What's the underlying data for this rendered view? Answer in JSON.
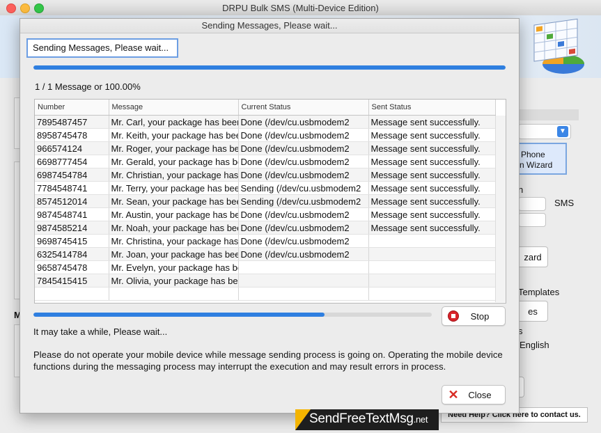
{
  "app": {
    "title": "DRPU Bulk SMS (Multi-Device Edition)"
  },
  "background": {
    "wizard_line1": "Phone",
    "wizard_line2": "n  Wizard",
    "sms_label": "SMS",
    "label_n": "n",
    "wizard_btn": "zard",
    "templates_label": "Templates",
    "es_btn": "es",
    "s_label": "s",
    "english_label": "English",
    "m_label": "M",
    "help_link": "Need Help? Click here to contact us."
  },
  "dialog": {
    "title": "Sending Messages, Please wait...",
    "status_box": "Sending Messages, Please wait...",
    "overall_progress": 1.0,
    "count_text": "1 / 1 Message or 100.00%",
    "columns": [
      "Number",
      "Message",
      "Current Status",
      "Sent Status"
    ],
    "rows": [
      {
        "number": "7895487457",
        "message": "Mr. Carl, your package has been",
        "status": "Done (/dev/cu.usbmodem2",
        "sent": "Message sent successfully."
      },
      {
        "number": "8958745478",
        "message": "Mr. Keith, your package has been",
        "status": "Done (/dev/cu.usbmodem2",
        "sent": "Message sent successfully."
      },
      {
        "number": "966574124",
        "message": "Mr. Roger, your package has been",
        "status": "Done (/dev/cu.usbmodem2",
        "sent": "Message sent successfully."
      },
      {
        "number": "6698777454",
        "message": "Mr. Gerald, your package has been",
        "status": "Done (/dev/cu.usbmodem2",
        "sent": "Message sent successfully."
      },
      {
        "number": "6987454784",
        "message": "Mr. Christian, your package has be",
        "status": "Done (/dev/cu.usbmodem2",
        "sent": "Message sent successfully."
      },
      {
        "number": "7784548741",
        "message": "Mr. Terry, your package has been",
        "status": "Sending (/dev/cu.usbmodem2",
        "sent": "Message sent successfully."
      },
      {
        "number": "8574512014",
        "message": "Mr. Sean, your package has been",
        "status": "Sending (/dev/cu.usbmodem2",
        "sent": "Message sent successfully."
      },
      {
        "number": "9874548741",
        "message": "Mr. Austin, your package has been",
        "status": "Done (/dev/cu.usbmodem2",
        "sent": "Message sent successfully."
      },
      {
        "number": "9874585214",
        "message": "Mr. Noah, your package has been",
        "status": "Done (/dev/cu.usbmodem2",
        "sent": "Message sent successfully."
      },
      {
        "number": "9698745415",
        "message": "Mr. Christina, your package has be",
        "status": "Done (/dev/cu.usbmodem2",
        "sent": ""
      },
      {
        "number": "6325414784",
        "message": "Mr. Joan, your package has been",
        "status": "Done (/dev/cu.usbmodem2",
        "sent": ""
      },
      {
        "number": "9658745478",
        "message": "Mr. Evelyn, your package has been",
        "status": "",
        "sent": ""
      },
      {
        "number": "7845415415",
        "message": "Mr. Olivia, your package has been",
        "status": "",
        "sent": ""
      },
      {
        "number": "",
        "message": "",
        "status": "",
        "sent": ""
      }
    ],
    "batch_progress": 0.73,
    "stop_label": "Stop",
    "wait_text": "It may take a while, Please wait...",
    "note_text": "Please do not operate your mobile device while message sending process is going on. Operating the mobile device functions during the messaging process may interrupt the execution and may result errors in process.",
    "close_label": "Close"
  },
  "watermark": {
    "main": "SendFreeTextMsg",
    "suffix": ".net"
  },
  "colors": {
    "accent": "#2f7fe0",
    "stop_red": "#d8232a",
    "close_red": "#d82a23"
  }
}
